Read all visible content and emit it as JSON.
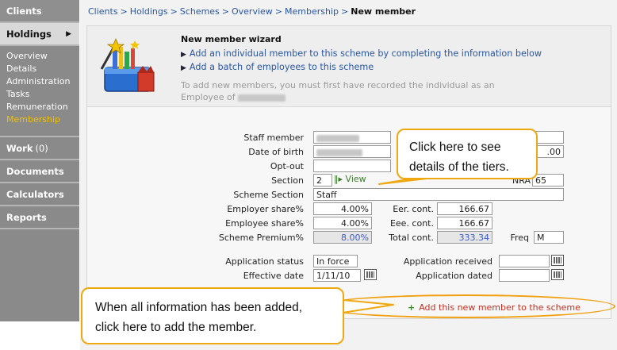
{
  "sidebar": {
    "clients": "Clients",
    "holdings": "Holdings",
    "holdings_arrow": "▶",
    "sub_items": [
      "Overview",
      "Details",
      "Administration",
      "Tasks",
      "Remuneration",
      "Membership"
    ],
    "work": "Work",
    "work_count": "(0)",
    "documents": "Documents",
    "calculators": "Calculators",
    "reports": "Reports"
  },
  "breadcrumb": {
    "items": [
      "Clients",
      "Holdings",
      "Schemes",
      "Overview",
      "Membership"
    ],
    "separator": ">",
    "current": "New member"
  },
  "wizard": {
    "title": "New member wizard",
    "link_individual": "Add an individual  member to this scheme by completing the information below",
    "link_batch": "Add a batch of employees to this scheme",
    "bullet": "▶",
    "note_prefix": "To add new members, you must first have recorded the individual as an",
    "note_employee": "Employee of"
  },
  "form": {
    "staff_member_label": "Staff member",
    "dob_label": "Date of birth",
    "dob_partial_value": ".00",
    "opt_out_label": "Opt-out",
    "section_label": "Section",
    "section_value": "2",
    "view_label": "View",
    "nra_label": "NRA",
    "nra_value": "65",
    "scheme_section_label": "Scheme Section",
    "scheme_section_value": "Staff",
    "employer_share_label": "Employer share%",
    "employer_share_value": "4.00%",
    "employee_share_label": "Employee share%",
    "employee_share_value": "4.00%",
    "scheme_premium_label": "Scheme Premium%",
    "scheme_premium_value": "8.00%",
    "eer_cont_label": "Eer. cont.",
    "eer_cont_value": "166.67",
    "eee_cont_label": "Eee. cont.",
    "eee_cont_value": "166.67",
    "total_cont_label": "Total cont.",
    "total_cont_value": "333.34",
    "freq_label": "Freq",
    "freq_value": "M",
    "application_status_label": "Application status",
    "application_status_value": "In force",
    "effective_date_label": "Effective date",
    "effective_date_value": "1/11/10",
    "application_received_label": "Application received",
    "application_dated_label": "Application dated"
  },
  "actions": {
    "add_member": "Add this new member to the scheme",
    "add_icon": "+"
  },
  "callouts": {
    "tiers": [
      "Click here to see",
      "details of the tiers."
    ],
    "add": [
      "When all information has been added,",
      "click here to add the member."
    ]
  },
  "colors": {
    "link": "#2a56a0",
    "active_menu": "#f0c000",
    "callout_border": "#f0a810",
    "action_red": "#c03020"
  }
}
